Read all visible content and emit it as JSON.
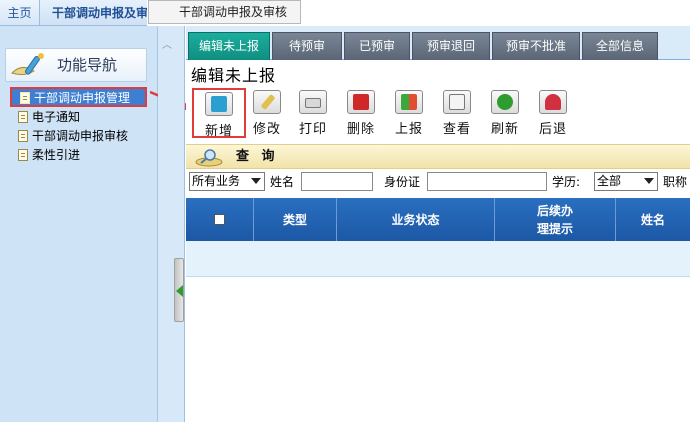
{
  "top_tabs": {
    "home": "主页",
    "current": "干部调动申报及审",
    "tooltip": "干部调动申报及审核"
  },
  "sidebar": {
    "header": "功能导航",
    "items": [
      {
        "label": "干部调动申报管理"
      },
      {
        "label": "电子通知"
      },
      {
        "label": "干部调动申报审核"
      },
      {
        "label": "柔性引进"
      }
    ]
  },
  "subtabs": [
    {
      "label": "编辑未上报"
    },
    {
      "label": "待预审"
    },
    {
      "label": "已预审"
    },
    {
      "label": "预审退回"
    },
    {
      "label": "预审不批准"
    },
    {
      "label": "全部信息"
    }
  ],
  "page_heading": "编辑未上报",
  "toolbar": [
    {
      "label": "新增"
    },
    {
      "label": "修改"
    },
    {
      "label": "打印"
    },
    {
      "label": "删除"
    },
    {
      "label": "上报"
    },
    {
      "label": "查看"
    },
    {
      "label": "刷新"
    },
    {
      "label": "后退"
    }
  ],
  "query": {
    "label": "查 询",
    "business_select": "所有业务",
    "name_label": "姓名",
    "id_label": "身份证",
    "education_label": "学历:",
    "education_select": "全部",
    "title_label": "职称"
  },
  "grid": {
    "columns": [
      "类型",
      "业务状态",
      "后续办理提示",
      "姓名"
    ],
    "col_type": "类型",
    "col_status": "业务状态",
    "col_hint_1": "后续办",
    "col_hint_2": "理提示",
    "col_name": "姓名"
  },
  "colors": {
    "active_tab": "#1cae9e",
    "grid_header": "#2a6fc0",
    "highlight": "#e23b3b"
  }
}
